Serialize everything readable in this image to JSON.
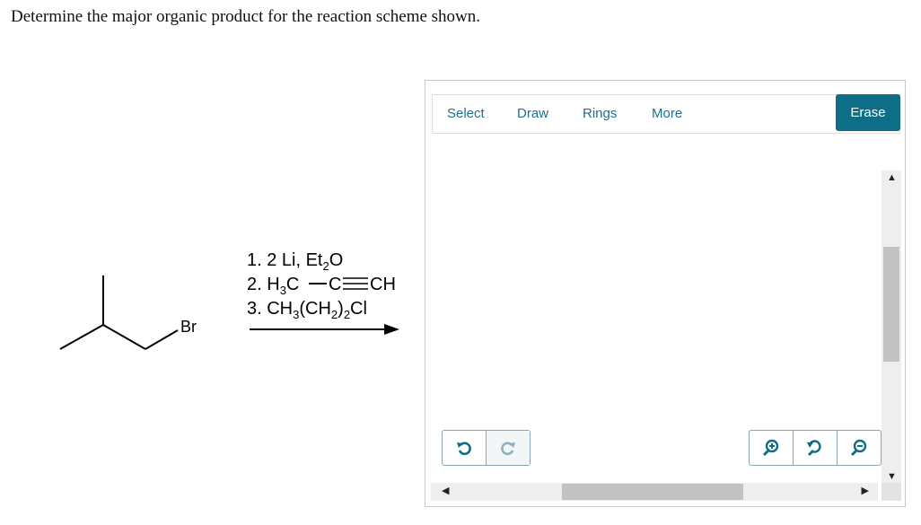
{
  "question": {
    "text": "Determine the major organic product for the reaction scheme shown."
  },
  "scheme": {
    "substituent_label": "Br",
    "step1": {
      "text": "1. 2 Li, Et",
      "sub": "2",
      "tail": "O"
    },
    "step2": {
      "pre": "2. H",
      "sub": "3",
      "c_text": "C",
      "c2_text": "C",
      "ch_text": "CH"
    },
    "step3": {
      "pre": "3. CH",
      "sub1": "3",
      "mid": "(CH",
      "sub2": "2",
      "post": ")",
      "sub3": "2",
      "tail": "Cl"
    }
  },
  "editor": {
    "tabs": {
      "select": "Select",
      "draw": "Draw",
      "rings": "Rings",
      "more": "More"
    },
    "erase_label": "Erase",
    "accent_color": "#0f6e87",
    "tab_color": "#1d6f8c",
    "vscroll_position": 0.36,
    "hscroll_position": 0.29
  }
}
